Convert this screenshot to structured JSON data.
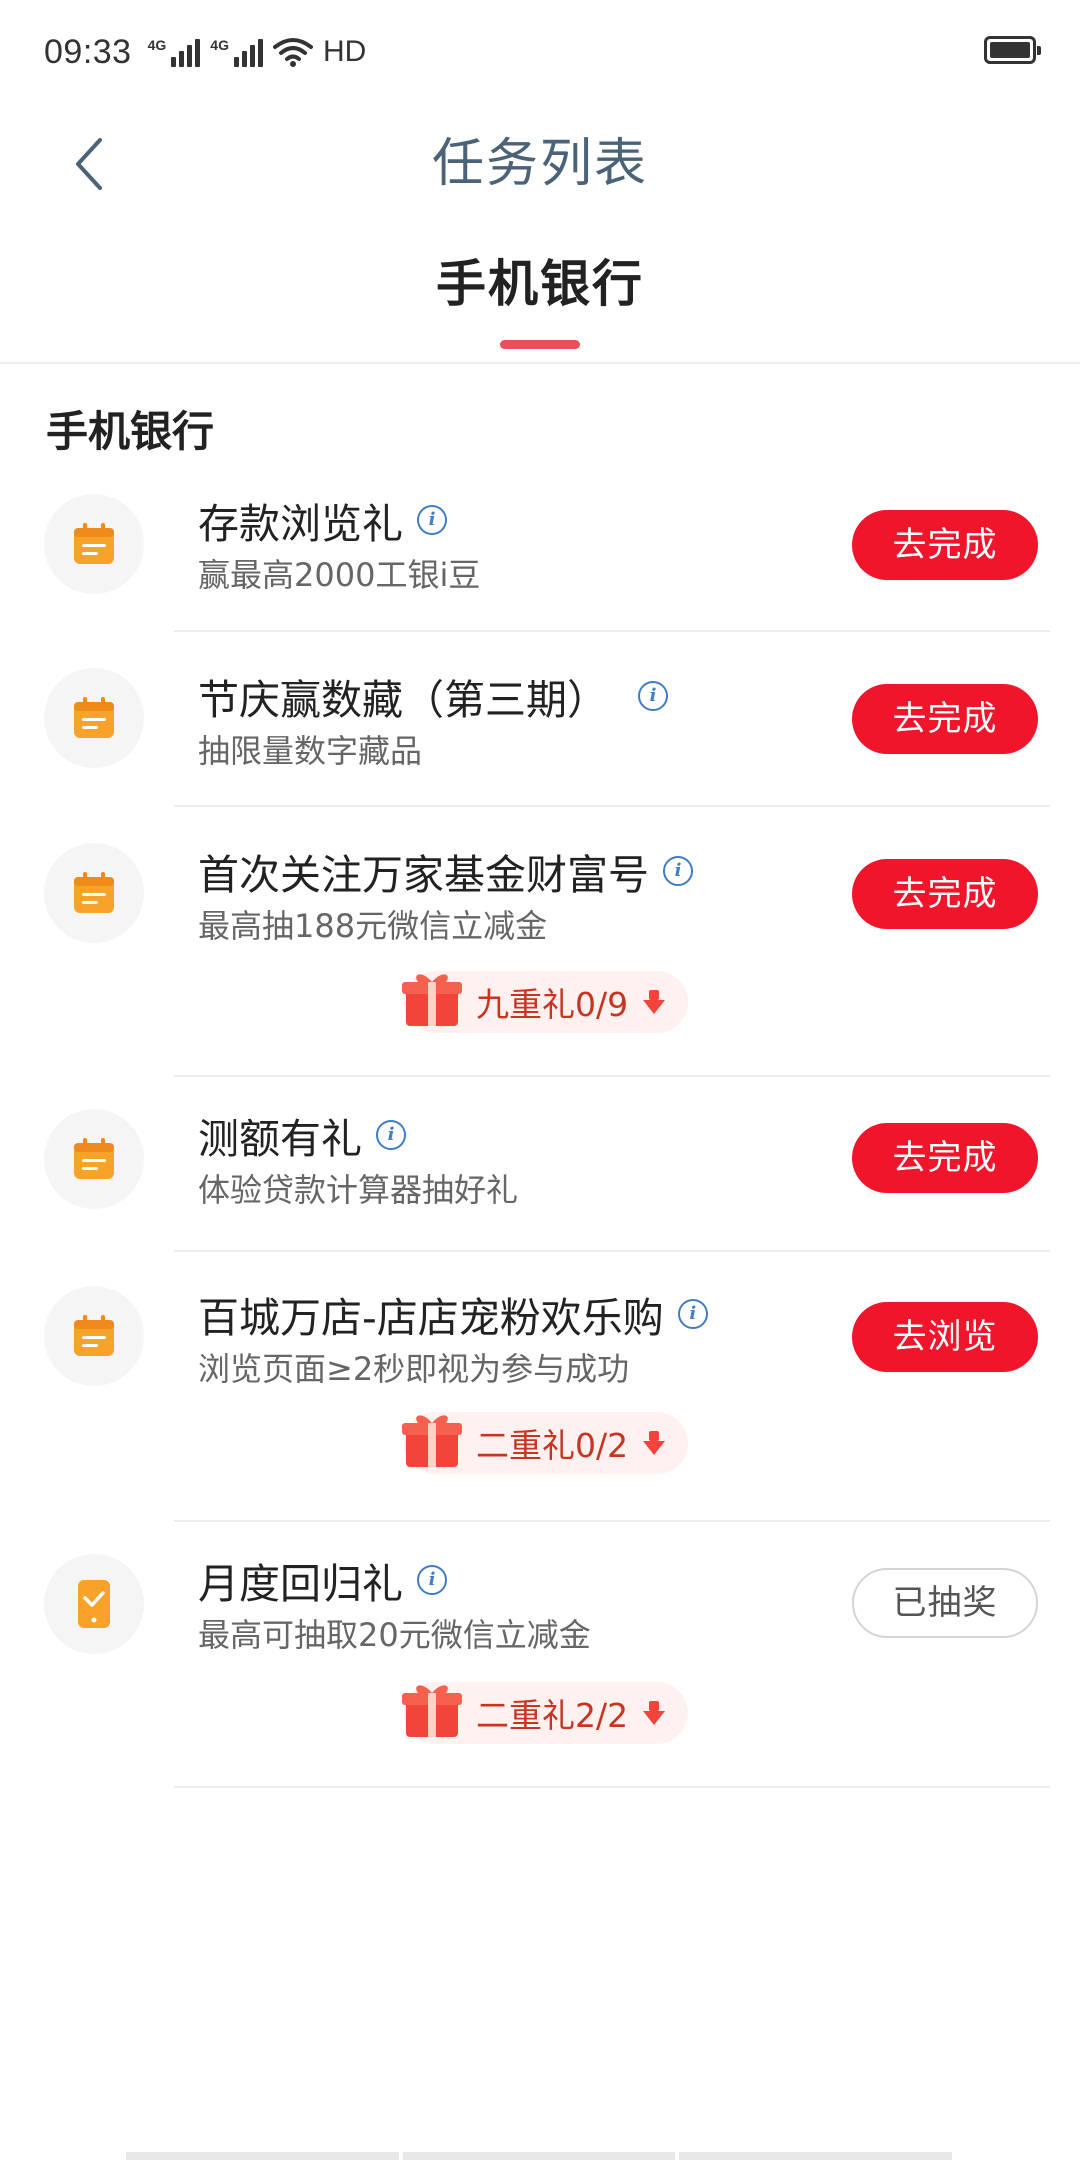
{
  "status_bar": {
    "time": "09:33",
    "network1": "4G",
    "network2": "4G",
    "hd": "HD"
  },
  "header": {
    "title": "任务列表",
    "back_icon": "chevron-left-icon"
  },
  "tabs": [
    {
      "label": "手机银行",
      "active": true
    }
  ],
  "section": {
    "title": "手机银行"
  },
  "tasks": [
    {
      "name": "存款浏览礼",
      "desc": "赢最高2000工银i豆",
      "action": "去完成",
      "icon": "calendar-icon"
    },
    {
      "name": "节庆赢数藏（第三期）",
      "desc": "抽限量数字藏品",
      "action": "去完成",
      "icon": "calendar-icon"
    },
    {
      "name": "首次关注万家基金财富号",
      "desc": "最高抽188元微信立减金",
      "action": "去完成",
      "icon": "calendar-icon",
      "gift": "九重礼0/9"
    },
    {
      "name": "测额有礼",
      "desc": "体验贷款计算器抽好礼",
      "action": "去完成",
      "icon": "calendar-icon"
    },
    {
      "name": "百城万店-店店宠粉欢乐购",
      "desc": "浏览页面≥2秒即视为参与成功",
      "action": "去浏览",
      "icon": "calendar-icon",
      "gift": "二重礼0/2"
    },
    {
      "name": "月度回归礼",
      "desc": "最高可抽取20元微信立减金",
      "action": "已抽奖",
      "icon": "phone-check-icon",
      "gift": "二重礼2/2"
    }
  ],
  "colors": {
    "accent_red": "#f0152a",
    "tab_indicator": "#e8505c",
    "icon_orange": "#f7a32a",
    "info_blue": "#3f7dc8",
    "title_color": "#4a6378"
  }
}
